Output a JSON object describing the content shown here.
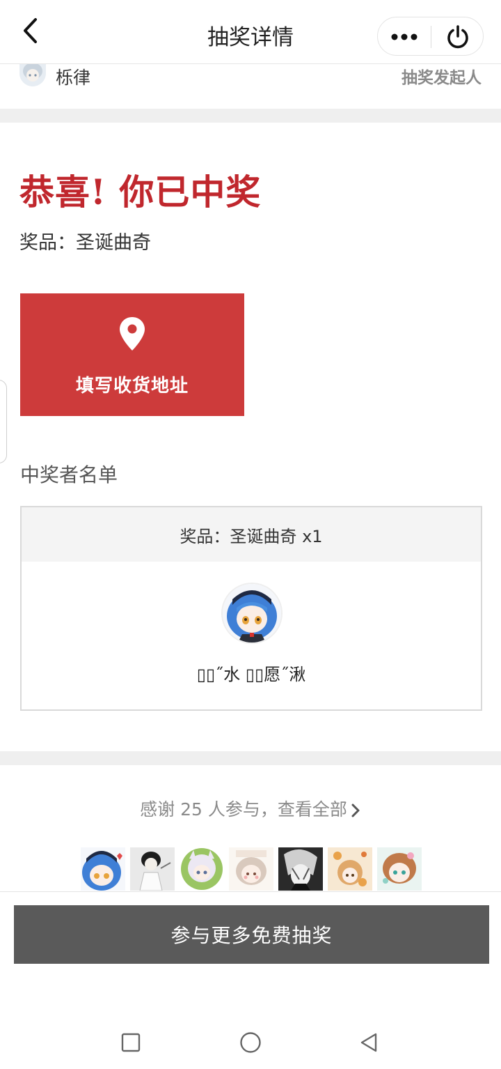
{
  "header": {
    "title": "抽奖详情",
    "back_icon": "chevron-left-icon",
    "more_icon": "more-dots-icon",
    "power_icon": "power-icon"
  },
  "initiator": {
    "name": "栎律",
    "role": "抽奖发起人"
  },
  "result": {
    "congrats": "恭喜! 你已中奖",
    "prize_line": "奖品：圣诞曲奇"
  },
  "address_button": {
    "label": "填写收货地址",
    "icon": "location-pin-icon"
  },
  "winners": {
    "heading": "中奖者名单",
    "prize_header": "奖品：圣诞曲奇 x1",
    "winner_name": "▯▯˝水 ▯▯愿˝湫"
  },
  "participants": {
    "thanks_text": "感谢 25 人参与，查看全部"
  },
  "join_button": {
    "label": "参与更多免费抽奖"
  },
  "colors": {
    "accent_red": "#cd3b3b",
    "title_red": "#c0272d",
    "button_gray": "#5a5a5a"
  }
}
